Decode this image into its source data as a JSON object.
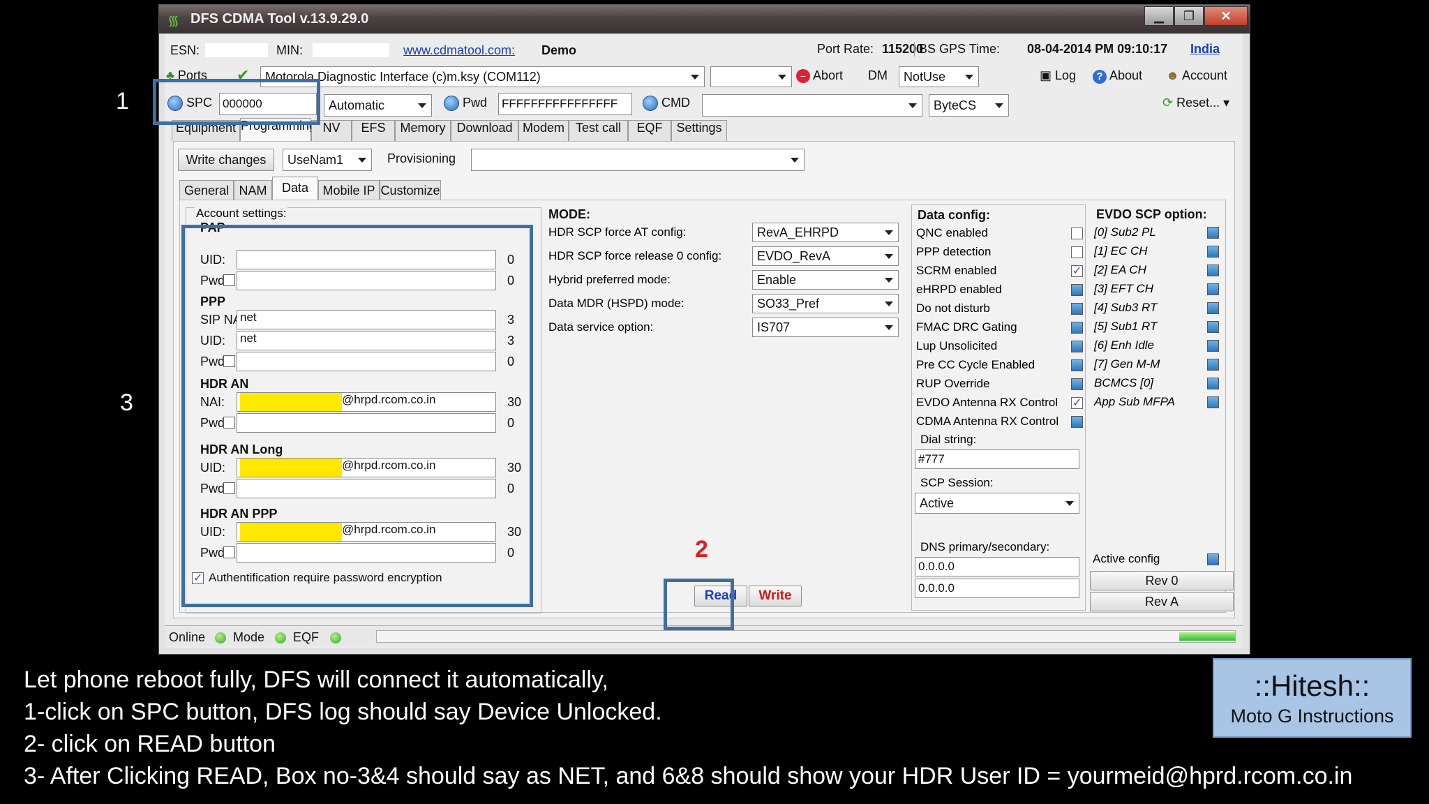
{
  "window": {
    "title": "DFS CDMA Tool v.13.9.29.0",
    "min": "▁",
    "max": "❐",
    "close": "✕"
  },
  "info": {
    "esn_label": "ESN:",
    "esn_value": "",
    "min_label": "MIN:",
    "min_value": "",
    "site": "www.cdmatool.com:",
    "demo": "Demo",
    "port_rate_label": "Port Rate:",
    "port_rate": "115200",
    "gps_label": "BS GPS Time:",
    "gps_time": "08-04-2014 PM 09:10:17",
    "country": "India"
  },
  "toolbar1": {
    "ports": "Ports",
    "device": "Motorola Diagnostic Interface (c)m.ksy (COM112)",
    "extra_combo": "",
    "abort": "Abort",
    "dm": "DM",
    "dm_value": "NotUse",
    "log": "Log",
    "about": "About",
    "account": "Account"
  },
  "toolbar2": {
    "spc": "SPC",
    "spc_value": "000000",
    "mode": "Automatic",
    "pwd": "Pwd",
    "pwd_value": "FFFFFFFFFFFFFFFF",
    "cmd": "CMD",
    "cmd_value": "",
    "bytecs": "ByteCS",
    "reset": "Reset..."
  },
  "main_tabs": [
    "Equipment",
    "Programming",
    "NV",
    "EFS",
    "Memory",
    "Download",
    "Modem",
    "Test call",
    "EQF",
    "Settings"
  ],
  "prog_bar": {
    "write_changes": "Write changes",
    "nam": "UseNam1",
    "provisioning": "Provisioning",
    "prov_value": ""
  },
  "sub_tabs": [
    "General",
    "NAM",
    "Data",
    "Mobile IP",
    "Customize"
  ],
  "account": {
    "legend": "Account settings:",
    "pap": "PAP",
    "ppp": "PPP",
    "hdr_an": "HDR AN",
    "hdr_an_long": "HDR AN Long",
    "hdr_an_ppp": "HDR AN PPP",
    "uid": "UID:",
    "pwd": "Pwd",
    "sip_nai": "SIP NAI",
    "nai": "NAI:",
    "pap_uid": "",
    "pap_uid_n": "0",
    "pap_pwd": "",
    "pap_pwd_n": "0",
    "ppp_sip": "net",
    "ppp_sip_n": "3",
    "ppp_uid": "net",
    "ppp_uid_n": "3",
    "ppp_pwd": "",
    "ppp_pwd_n": "0",
    "an_nai": "@hrpd.rcom.co.in",
    "an_nai_n": "30",
    "an_pwd": "",
    "an_pwd_n": "0",
    "long_uid": "@hrpd.rcom.co.in",
    "long_uid_n": "30",
    "long_pwd": "",
    "long_pwd_n": "0",
    "appp_uid": "@hrpd.rcom.co.in",
    "appp_uid_n": "30",
    "appp_pwd": "",
    "appp_pwd_n": "0",
    "auth": "Authentification require password encryption"
  },
  "mode": {
    "title": "MODE:",
    "rows": [
      {
        "label": "HDR SCP force AT config:",
        "value": "RevA_EHRPD"
      },
      {
        "label": "HDR SCP force release 0 config:",
        "value": "EVDO_RevA"
      },
      {
        "label": "Hybrid preferred mode:",
        "value": "Enable"
      },
      {
        "label": "Data MDR (HSPD) mode:",
        "value": "SO33_Pref"
      },
      {
        "label": "Data service option:",
        "value": "IS707"
      }
    ]
  },
  "data_config": {
    "title": "Data config:",
    "items": [
      "QNC enabled",
      "PPP detection",
      "SCRM enabled",
      "eHRPD enabled",
      "Do not disturb",
      "FMAC DRC Gating",
      "Lup Unsolicited",
      "Pre CC Cycle Enabled",
      "RUP Override",
      "EVDO Antenna RX Control",
      "CDMA Antenna RX Control"
    ],
    "dial_label": "Dial string:",
    "dial": "#777",
    "scp_label": "SCP Session:",
    "scp": "Active",
    "dns_label": "DNS primary/secondary:",
    "dns1": "0.0.0.0",
    "dns2": "0.0.0.0"
  },
  "evdo": {
    "title": "EVDO SCP option:",
    "items": [
      "[0] Sub2 PL",
      "[1] EC CH",
      "[2] EA CH",
      "[3] EFT CH",
      "[4] Sub3 RT",
      "[5] Sub1 RT",
      "[6] Enh Idle",
      "[7] Gen M-M",
      "BCMCS [0]",
      "App Sub MFPA"
    ],
    "active_config": "Active config",
    "rev0": "Rev 0",
    "reva": "Rev A"
  },
  "actions": {
    "read": "Read",
    "write": "Write"
  },
  "status": {
    "online": "Online",
    "mode": "Mode",
    "eqf": "EQF"
  },
  "annotations": {
    "n1": "1",
    "n2": "2",
    "n3": "3"
  },
  "instructions": [
    "Let phone reboot fully, DFS will connect it automatically,",
    "1-click on SPC button, DFS log should say Device  Unlocked.",
    "2- click on READ button",
    "3- After Clicking READ, Box no-3&4 should say as NET, and 6&8 should show your HDR User ID = yourmeid@hprd.rcom.co.in"
  ],
  "badge": {
    "name": "::Hitesh::",
    "sub": "Moto G Instructions"
  },
  "colors": {
    "annotation_box": "#3f6ea3",
    "read": "#1a3cc8",
    "write": "#d01818"
  }
}
